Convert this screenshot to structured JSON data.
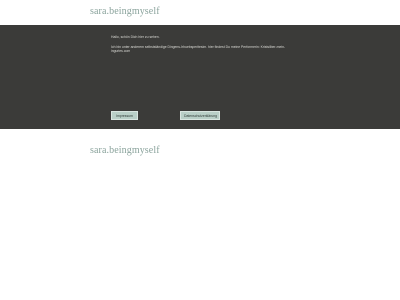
{
  "site": {
    "logo_text": "sara.beingmyself"
  },
  "consent": {
    "greeting": "Hallo, schön Dich hier zu sehen.",
    "body": "Ich bin unter anderem selbstständige Dingens-Irhuebsperitesim. hier findest Du meine Performerin: Kristsilber-mein-inguries.com",
    "impressum_label": "Impressum",
    "privacy_label": "Datenschutzerklärung"
  }
}
